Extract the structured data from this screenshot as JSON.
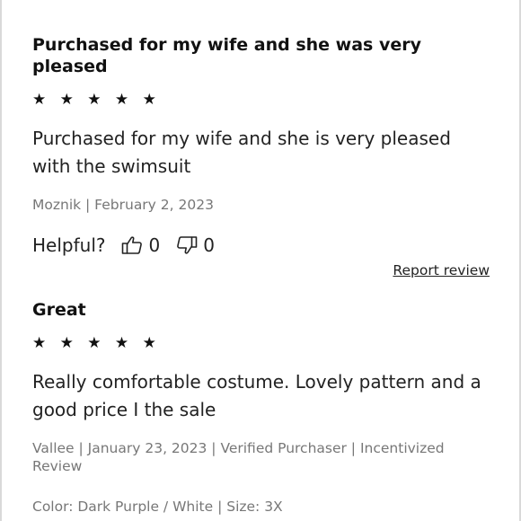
{
  "reviews": [
    {
      "title": "Purchased for my wife and she was very pleased",
      "stars": "★ ★ ★ ★ ★",
      "rating": 5,
      "body": "Purchased for my wife and she is very pleased with the swimsuit",
      "meta": "Moznik | February 2, 2023",
      "helpful_label": "Helpful?",
      "thumbs_up_count": "0",
      "thumbs_down_count": "0",
      "report_label": "Report review"
    },
    {
      "title": "Great",
      "stars": "★ ★ ★ ★ ★",
      "rating": 5,
      "body": "Really comfortable costume. Lovely pattern and a good price I the sale",
      "meta": "Vallee | January 23, 2023 | Verified Purchaser | Incentivized Review",
      "attributes": "Color: Dark Purple / White | Size: 3X"
    }
  ],
  "icons": {
    "thumbs_up": "thumbs-up-outline",
    "thumbs_down": "thumbs-down-outline"
  }
}
